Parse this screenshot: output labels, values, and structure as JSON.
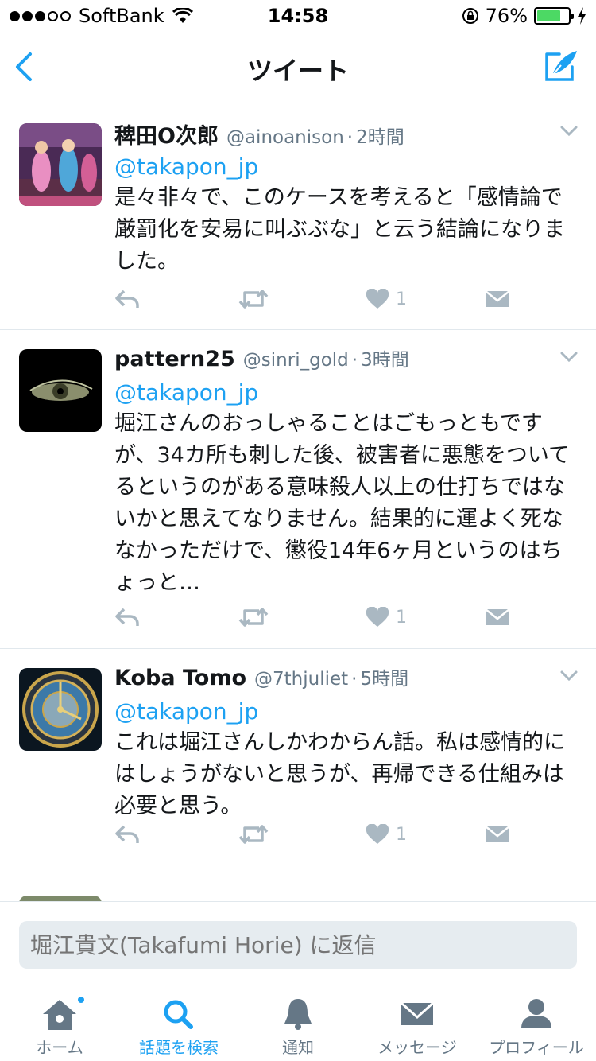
{
  "status_bar": {
    "carrier": "SoftBank",
    "time": "14:58",
    "battery": "76%",
    "battery_level": 0.76
  },
  "nav": {
    "title": "ツイート"
  },
  "tweets": [
    {
      "name": "稗田O次郎",
      "handle": "@ainoanison",
      "time": "2時間",
      "mention": "@takapon_jp",
      "text": "是々非々で、このケースを考えると「感情論で厳罰化を安易に叫ぶぶな」と云う結論になりました。",
      "likes": "1"
    },
    {
      "name": "pattern25",
      "handle": "@sinri_gold",
      "time": "3時間",
      "mention": "@takapon_jp",
      "text": "堀江さんのおっしゃることはごもっともですが、34カ所も刺した後、被害者に悪態をついてるというのがある意味殺人以上の仕打ちではないかと思えてなりません。結果的に運よく死ななかっただけで、懲役14年6ヶ月というのはちょっと…",
      "likes": "1"
    },
    {
      "name": "Koba Tomo",
      "handle": "@7thjuliet",
      "time": "5時間",
      "mention": "@takapon_jp",
      "text": "これは堀江さんしかわからん話。私は感情的にはしょうがないと思うが、再帰できる仕組みは必要と思う。",
      "likes": "1"
    }
  ],
  "reply": {
    "placeholder": "堀江貴文(Takafumi Horie) に返信"
  },
  "tabs": [
    {
      "label": "ホーム",
      "icon": "home-icon"
    },
    {
      "label": "話題を検索",
      "icon": "search-icon"
    },
    {
      "label": "通知",
      "icon": "bell-icon"
    },
    {
      "label": "メッセージ",
      "icon": "envelope-icon"
    },
    {
      "label": "プロフィール",
      "icon": "person-icon"
    }
  ],
  "colors": {
    "accent": "#1da1f2",
    "text": "#14171a",
    "secondary": "#657786",
    "action": "#aab8c2"
  }
}
